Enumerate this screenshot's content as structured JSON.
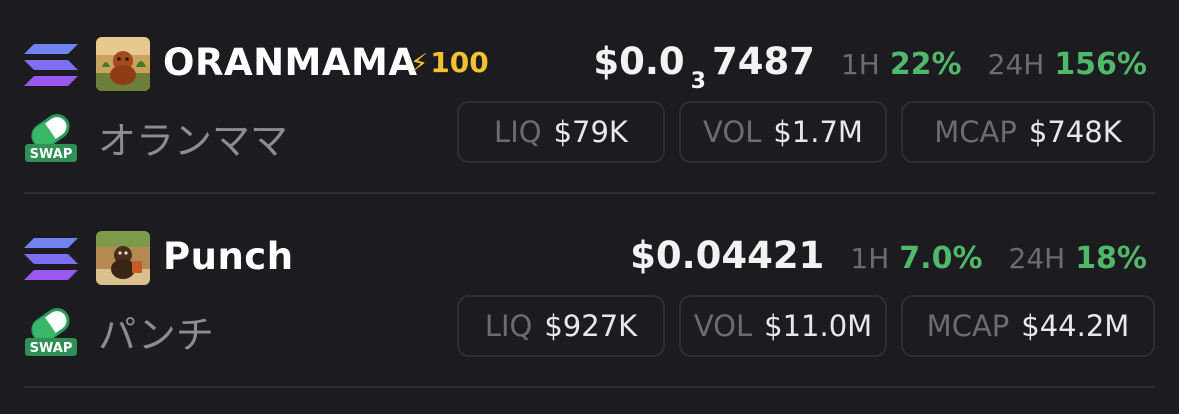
{
  "tokens": [
    {
      "symbol": "ORANMAMA",
      "boost": "100",
      "jp_name": "オランママ",
      "price_prefix": "$0.0",
      "price_sub": "3",
      "price_suffix": "7487",
      "h1_label": "1H",
      "h1_change": "22%",
      "h24_label": "24H",
      "h24_change": "156%",
      "liq_label": "LIQ",
      "liq_value": "$79K",
      "vol_label": "VOL",
      "vol_value": "$1.7M",
      "mcap_label": "MCAP",
      "mcap_value": "$748K",
      "chain_icon": "solana-icon",
      "swap_icon": "swap-icon"
    },
    {
      "symbol": "Punch",
      "jp_name": "パンチ",
      "price": "$0.04421",
      "h1_label": "1H",
      "h1_change": "7.0%",
      "h24_label": "24H",
      "h24_change": "18%",
      "liq_label": "LIQ",
      "liq_value": "$927K",
      "vol_label": "VOL",
      "vol_value": "$11.0M",
      "mcap_label": "MCAP",
      "mcap_value": "$44.2M",
      "chain_icon": "solana-icon",
      "swap_icon": "swap-icon"
    }
  ],
  "colors": {
    "background": "#1c1c20",
    "positive": "#4fb86b",
    "boost": "#f2c230",
    "muted": "#6b6b72",
    "border": "#2e2e33"
  }
}
